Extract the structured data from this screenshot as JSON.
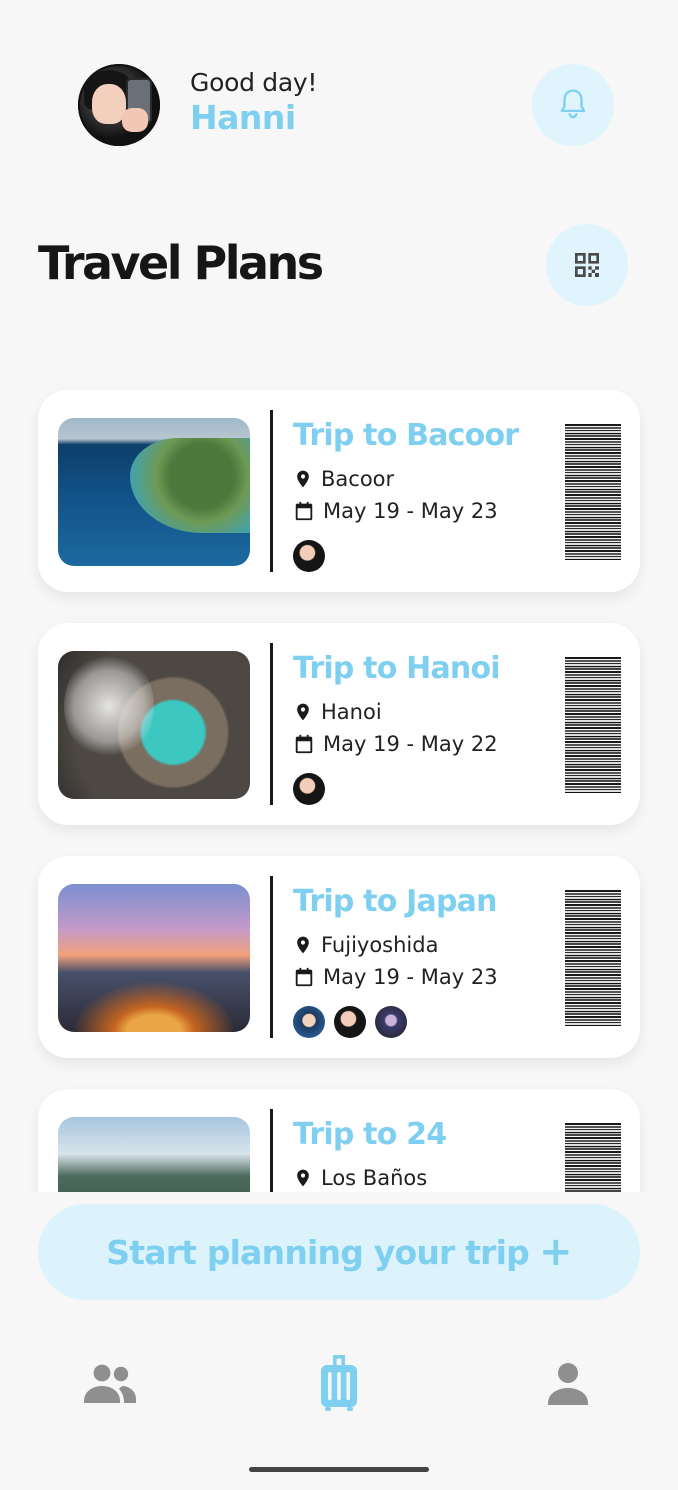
{
  "header": {
    "greeting": "Good day!",
    "user_name": "Hanni",
    "avatar_icon": "user-avatar-photo",
    "notification_icon": "bell-icon"
  },
  "page": {
    "title": "Travel Plans",
    "qr_icon": "qr-code-icon"
  },
  "trips": [
    {
      "title": "Trip to Bacoor",
      "location": "Bacoor",
      "dates": "May 19 - May 23",
      "members": [
        "hanni-avatar"
      ]
    },
    {
      "title": "Trip to Hanoi",
      "location": "Hanoi",
      "dates": "May 19 - May 22",
      "members": [
        "hanni-avatar"
      ]
    },
    {
      "title": "Trip to Japan",
      "location": "Fujiyoshida",
      "dates": "May 19 - May 23",
      "members": [
        "member-avatar-1",
        "hanni-avatar",
        "member-avatar-3"
      ]
    },
    {
      "title": "Trip to 24",
      "location": "Los Baños",
      "dates": "",
      "members": []
    }
  ],
  "cta": {
    "label": "Start planning your trip",
    "plus": "+"
  },
  "nav": {
    "items": [
      "people-icon",
      "luggage-icon",
      "person-icon"
    ],
    "active": "luggage-icon"
  },
  "colors": {
    "accent": "#7ecff0",
    "accent_bg": "#dff4fd",
    "background": "#f7f7f7"
  }
}
